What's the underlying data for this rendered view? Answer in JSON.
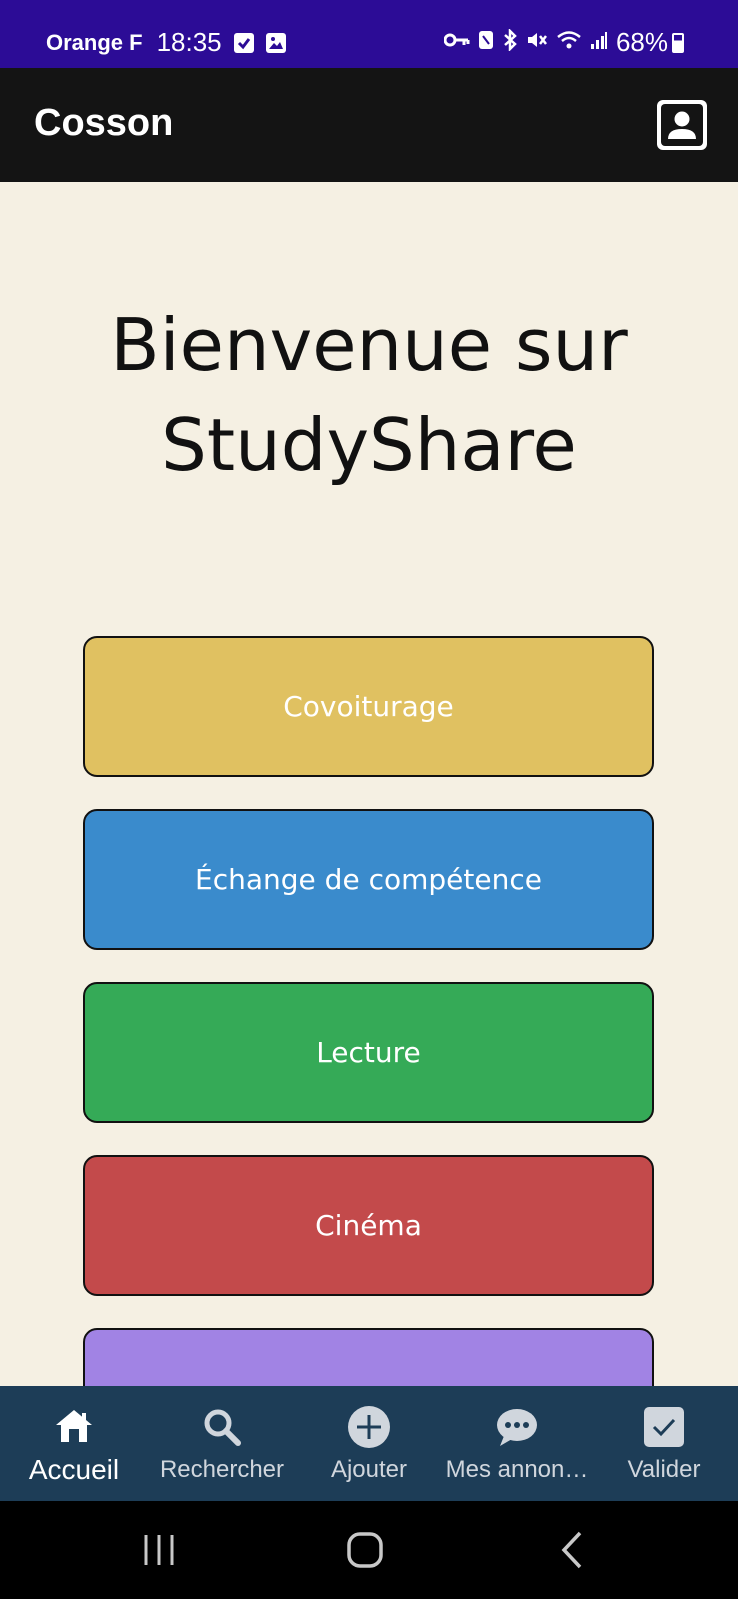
{
  "status_bar": {
    "carrier": "Orange F",
    "time": "18:35",
    "battery": "68%",
    "icons": [
      "checkbox-notification-icon",
      "gallery-notification-icon",
      "vpn-key-icon",
      "nfc-icon",
      "bluetooth-icon",
      "mute-icon",
      "wifi-icon",
      "signal-icon",
      "battery-icon"
    ]
  },
  "app_bar": {
    "title": "Cosson",
    "profile_icon": "account-box-icon"
  },
  "main": {
    "welcome_line1": "Bienvenue sur",
    "welcome_line2": "StudyShare",
    "buttons": [
      {
        "label": "Covoiturage",
        "color": "#e0c161"
      },
      {
        "label": "Échange de compétence",
        "color": "#3a8bcc"
      },
      {
        "label": "Lecture",
        "color": "#35aa57"
      },
      {
        "label": "Cinéma",
        "color": "#c34a4b"
      },
      {
        "label": "",
        "color": "#a183e4"
      }
    ]
  },
  "bottom_nav": {
    "items": [
      {
        "label": "Accueil",
        "icon": "home-icon",
        "active": true
      },
      {
        "label": "Rechercher",
        "icon": "search-icon",
        "active": false
      },
      {
        "label": "Ajouter",
        "icon": "add-circle-icon",
        "active": false
      },
      {
        "label": "Mes annon…",
        "icon": "chat-bubble-icon",
        "active": false
      },
      {
        "label": "Valider",
        "icon": "check-box-icon",
        "active": false
      }
    ]
  },
  "colors": {
    "status_bar": "#2c0c96",
    "app_bar": "#141414",
    "background": "#f5f0e3",
    "bottom_nav": "#1d3d57",
    "system_nav": "#000000"
  }
}
